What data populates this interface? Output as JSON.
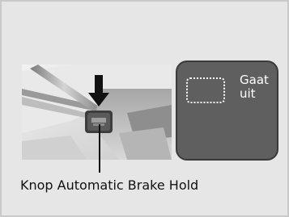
{
  "indicator": {
    "status_line1": "Gaat",
    "status_line2": "uit"
  },
  "caption": {
    "label": "Knop Automatic Brake Hold"
  },
  "icons": {
    "button_arrow": "down-arrow-icon",
    "indicator_placeholder": "brake-hold-indicator-icon"
  },
  "colors": {
    "background": "#e6e6e6",
    "panel": "#5f5f5f",
    "arrow": "#111111"
  }
}
